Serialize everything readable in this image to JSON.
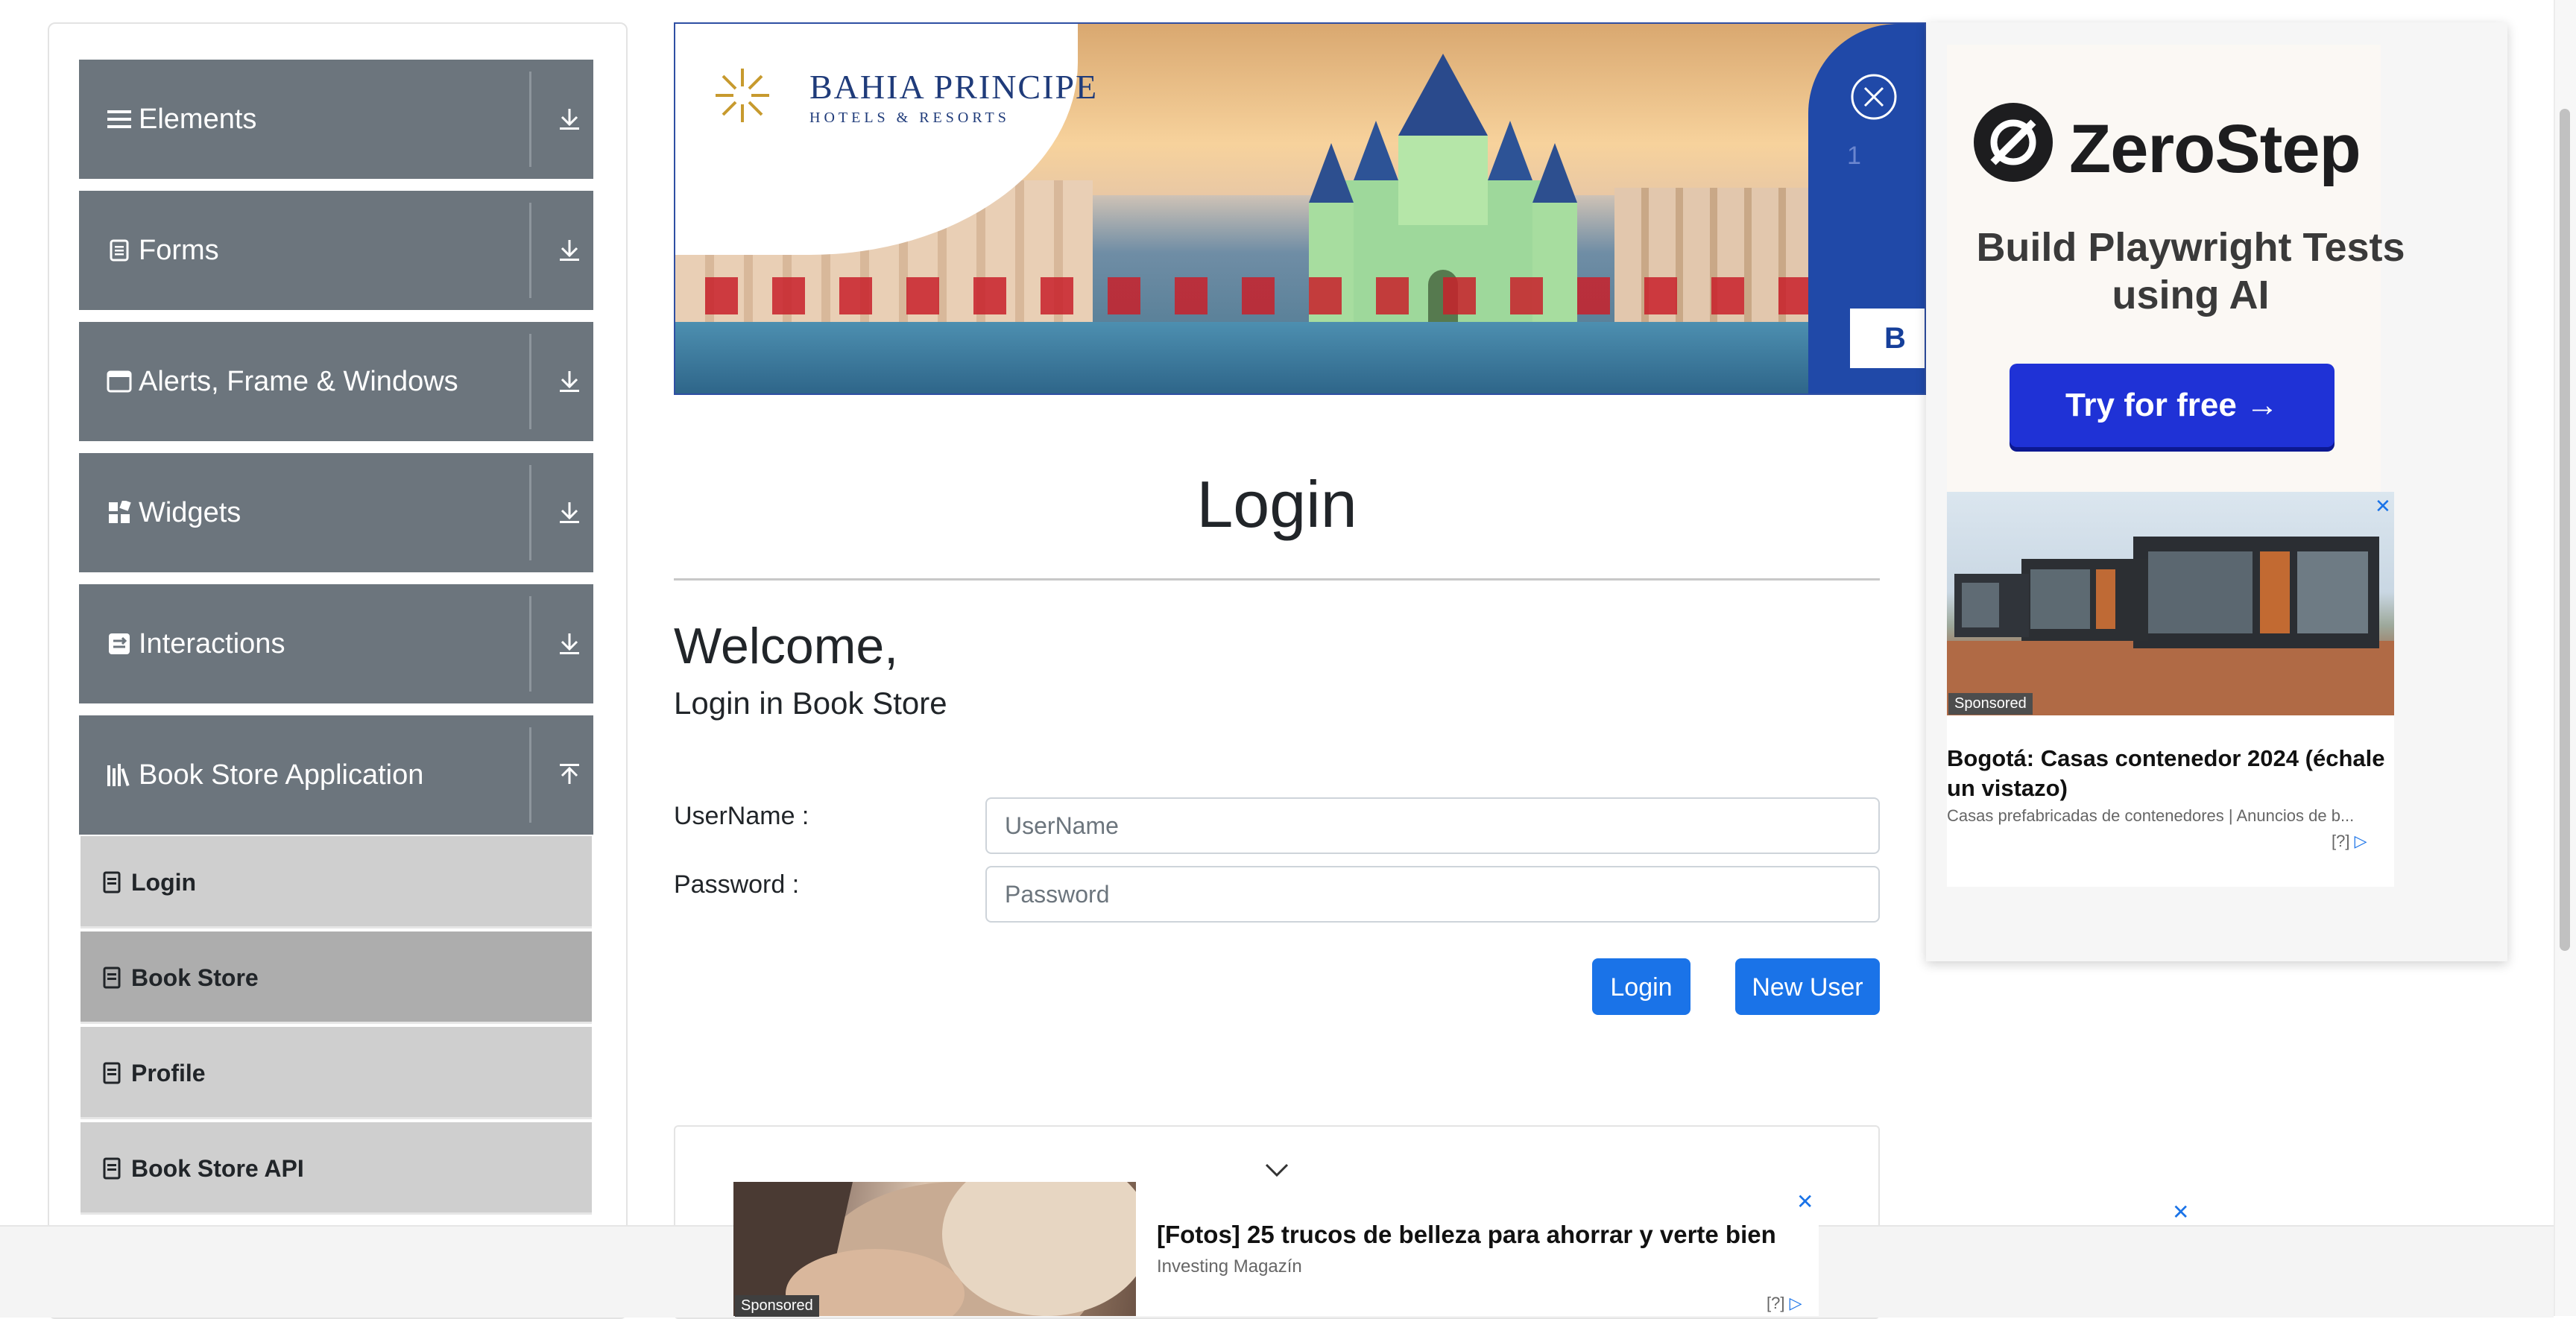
{
  "sidebar": {
    "groups": [
      {
        "label": "Elements",
        "icon": "hamburger-icon",
        "arrow": "download-arrow-icon"
      },
      {
        "label": "Forms",
        "icon": "document-icon",
        "arrow": "download-arrow-icon"
      },
      {
        "label": "Alerts, Frame & Windows",
        "icon": "window-icon",
        "arrow": "download-arrow-icon"
      },
      {
        "label": "Widgets",
        "icon": "widgets-icon",
        "arrow": "download-arrow-icon"
      },
      {
        "label": "Interactions",
        "icon": "interactions-icon",
        "arrow": "download-arrow-icon"
      },
      {
        "label": "Book Store Application",
        "icon": "books-icon",
        "arrow": "upload-arrow-icon"
      }
    ],
    "book_store_items": [
      {
        "label": "Login",
        "active": false
      },
      {
        "label": "Book Store",
        "active": true
      },
      {
        "label": "Profile",
        "active": false
      },
      {
        "label": "Book Store API",
        "active": false
      }
    ]
  },
  "banner_ad": {
    "brand": "BAHIA PRINCIPE",
    "brand_sub": "HOTELS & RESORTS",
    "side_button": "B",
    "side_number": "1"
  },
  "right_ad": {
    "brand": "ZeroStep",
    "tagline": "Build Playwright Tests using AI",
    "cta": "Try for free →",
    "native": {
      "badge": "Sponsored",
      "title": "Bogotá: Casas contenedor 2024 (échale un vistazo)",
      "subtitle": "Casas prefabricadas de contenedores | Anuncios de b...",
      "info": "[?]",
      "close": "✕"
    }
  },
  "login": {
    "title": "Login",
    "welcome": "Welcome,",
    "subtitle": "Login in Book Store",
    "username_label": "UserName :",
    "username_placeholder": "UserName",
    "password_label": "Password :",
    "password_placeholder": "Password",
    "login_button": "Login",
    "new_user_button": "New User"
  },
  "bottom_ad": {
    "badge": "Sponsored",
    "title": "[Fotos] 25 trucos de belleza para ahorrar y verte bien",
    "source": "Investing Magazín",
    "info": "[?]",
    "close": "✕",
    "outer_close": "✕"
  },
  "colors": {
    "sidebar_group_bg": "#6c757d",
    "sidebar_sub_bg": "#cfcfcf",
    "sidebar_sub_active_bg": "#adadad",
    "primary_button": "#1a73e8",
    "zerostep_button": "#1f32d6",
    "banner_blue": "#2049a8"
  }
}
